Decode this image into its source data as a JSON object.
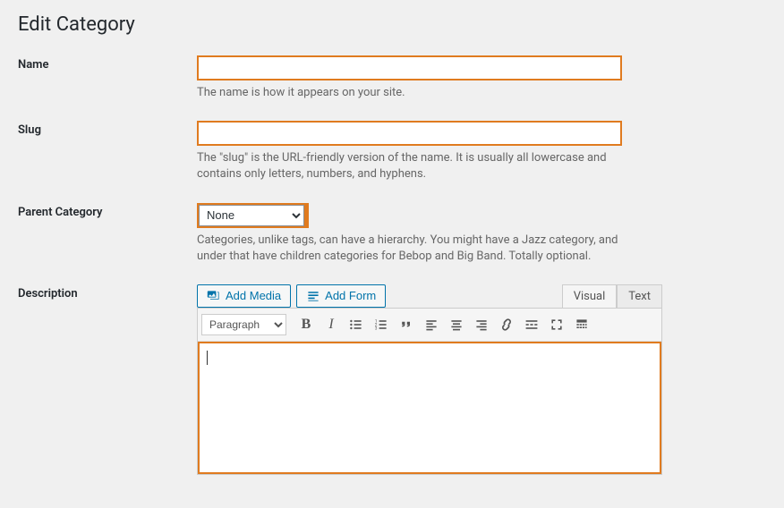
{
  "page": {
    "title": "Edit Category"
  },
  "fields": {
    "name": {
      "label": "Name",
      "value": "",
      "help": "The name is how it appears on your site."
    },
    "slug": {
      "label": "Slug",
      "value": "",
      "help": "The \"slug\" is the URL-friendly version of the name. It is usually all lowercase and contains only letters, numbers, and hyphens."
    },
    "parent": {
      "label": "Parent Category",
      "selected": "None",
      "help": "Categories, unlike tags, can have a hierarchy. You might have a Jazz category, and under that have children categories for Bebop and Big Band. Totally optional."
    },
    "description": {
      "label": "Description"
    }
  },
  "editor": {
    "add_media": "Add Media",
    "add_form": "Add Form",
    "tabs": {
      "visual": "Visual",
      "text": "Text"
    },
    "format_dropdown": "Paragraph"
  }
}
